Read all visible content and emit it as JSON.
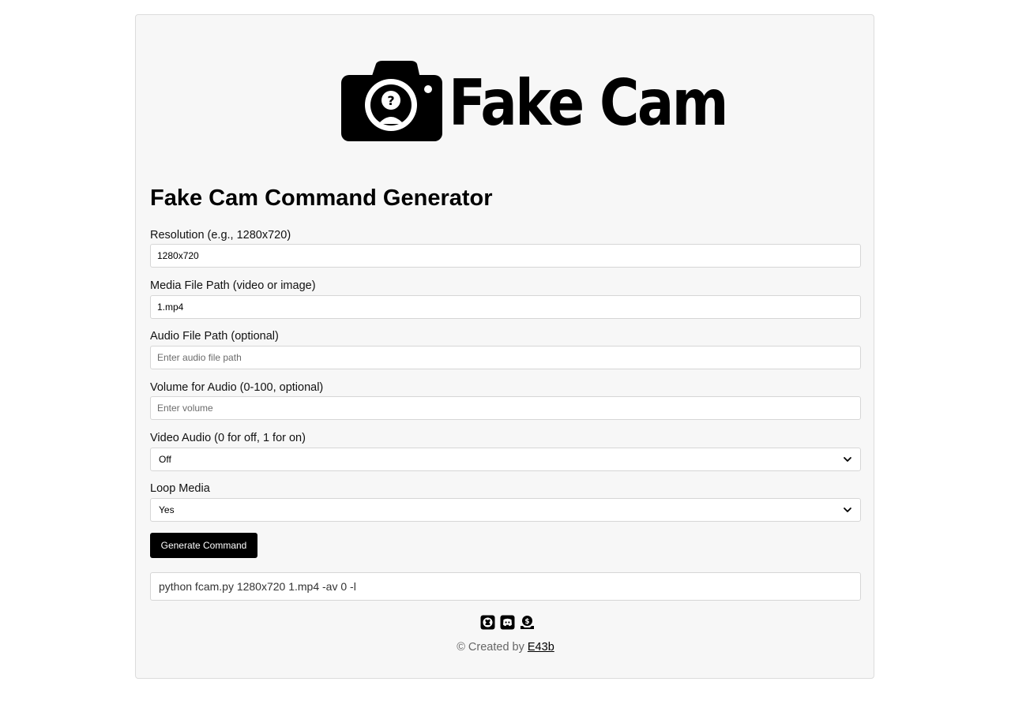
{
  "header": {
    "logo_text": "Fake Cam",
    "title": "Fake Cam Command Generator"
  },
  "form": {
    "resolution": {
      "label": "Resolution (e.g., 1280x720)",
      "value": "1280x720"
    },
    "media_path": {
      "label": "Media File Path (video or image)",
      "value": "1.mp4"
    },
    "audio_path": {
      "label": "Audio File Path (optional)",
      "value": "",
      "placeholder": "Enter audio file path"
    },
    "volume": {
      "label": "Volume for Audio (0-100, optional)",
      "value": "",
      "placeholder": "Enter volume"
    },
    "video_audio": {
      "label": "Video Audio (0 for off, 1 for on)",
      "selected": "Off"
    },
    "loop_media": {
      "label": "Loop Media",
      "selected": "Yes"
    },
    "generate_label": "Generate Command"
  },
  "output": {
    "command": "python fcam.py 1280x720 1.mp4 -av 0 -l"
  },
  "footer": {
    "icons": [
      "github-icon",
      "discord-icon",
      "donate-icon"
    ],
    "created_by_text": "© Created by",
    "author": "E43b"
  }
}
